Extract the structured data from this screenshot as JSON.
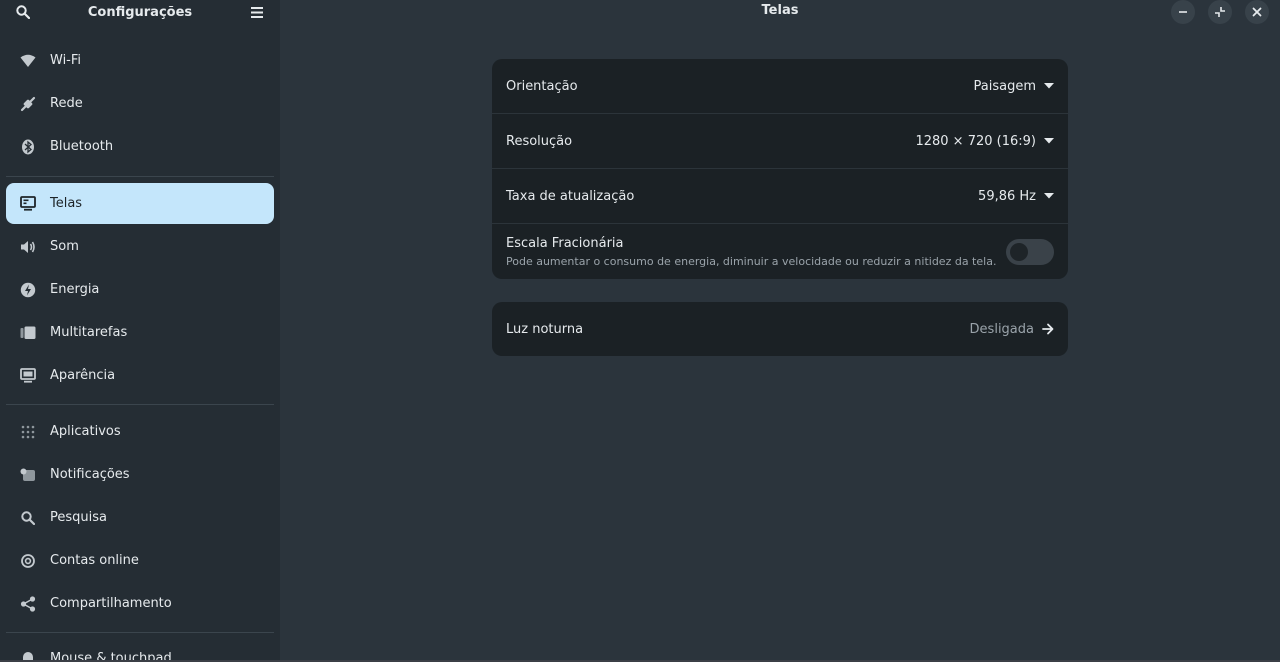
{
  "sidebar": {
    "title": "Configurações",
    "items": [
      {
        "label": "Wi-Fi",
        "icon": "wifi-icon"
      },
      {
        "label": "Rede",
        "icon": "network-icon"
      },
      {
        "label": "Bluetooth",
        "icon": "bluetooth-icon"
      },
      {
        "label": "Telas",
        "icon": "display-icon",
        "active": true
      },
      {
        "label": "Som",
        "icon": "speaker-icon"
      },
      {
        "label": "Energia",
        "icon": "power-icon"
      },
      {
        "label": "Multitarefas",
        "icon": "multitasking-icon"
      },
      {
        "label": "Aparência",
        "icon": "appearance-icon"
      },
      {
        "label": "Aplicativos",
        "icon": "apps-grid-icon"
      },
      {
        "label": "Notificações",
        "icon": "notifications-icon"
      },
      {
        "label": "Pesquisa",
        "icon": "search-icon"
      },
      {
        "label": "Contas online",
        "icon": "online-accounts-icon"
      },
      {
        "label": "Compartilhamento",
        "icon": "share-icon"
      },
      {
        "label": "Mouse & touchpad",
        "icon": "mouse-icon"
      }
    ]
  },
  "window": {
    "title": "Telas"
  },
  "display_settings": {
    "orientation": {
      "label": "Orientação",
      "value": "Paisagem"
    },
    "resolution": {
      "label": "Resolução",
      "value": "1280 × 720 (16:9)"
    },
    "refresh_rate": {
      "label": "Taxa de atualização",
      "value": "59,86 Hz"
    },
    "fractional_scaling": {
      "label": "Escala Fracionária",
      "subtitle": "Pode aumentar o consumo de energia, diminuir a velocidade ou reduzir a nitidez da tela.",
      "enabled": false
    }
  },
  "night_light": {
    "label": "Luz noturna",
    "value": "Desligada"
  },
  "colors": {
    "accent_selected": "#c4e6fb",
    "card_bg": "#1b2125",
    "main_bg": "#2b343c",
    "sidebar_bg": "#252d34"
  }
}
